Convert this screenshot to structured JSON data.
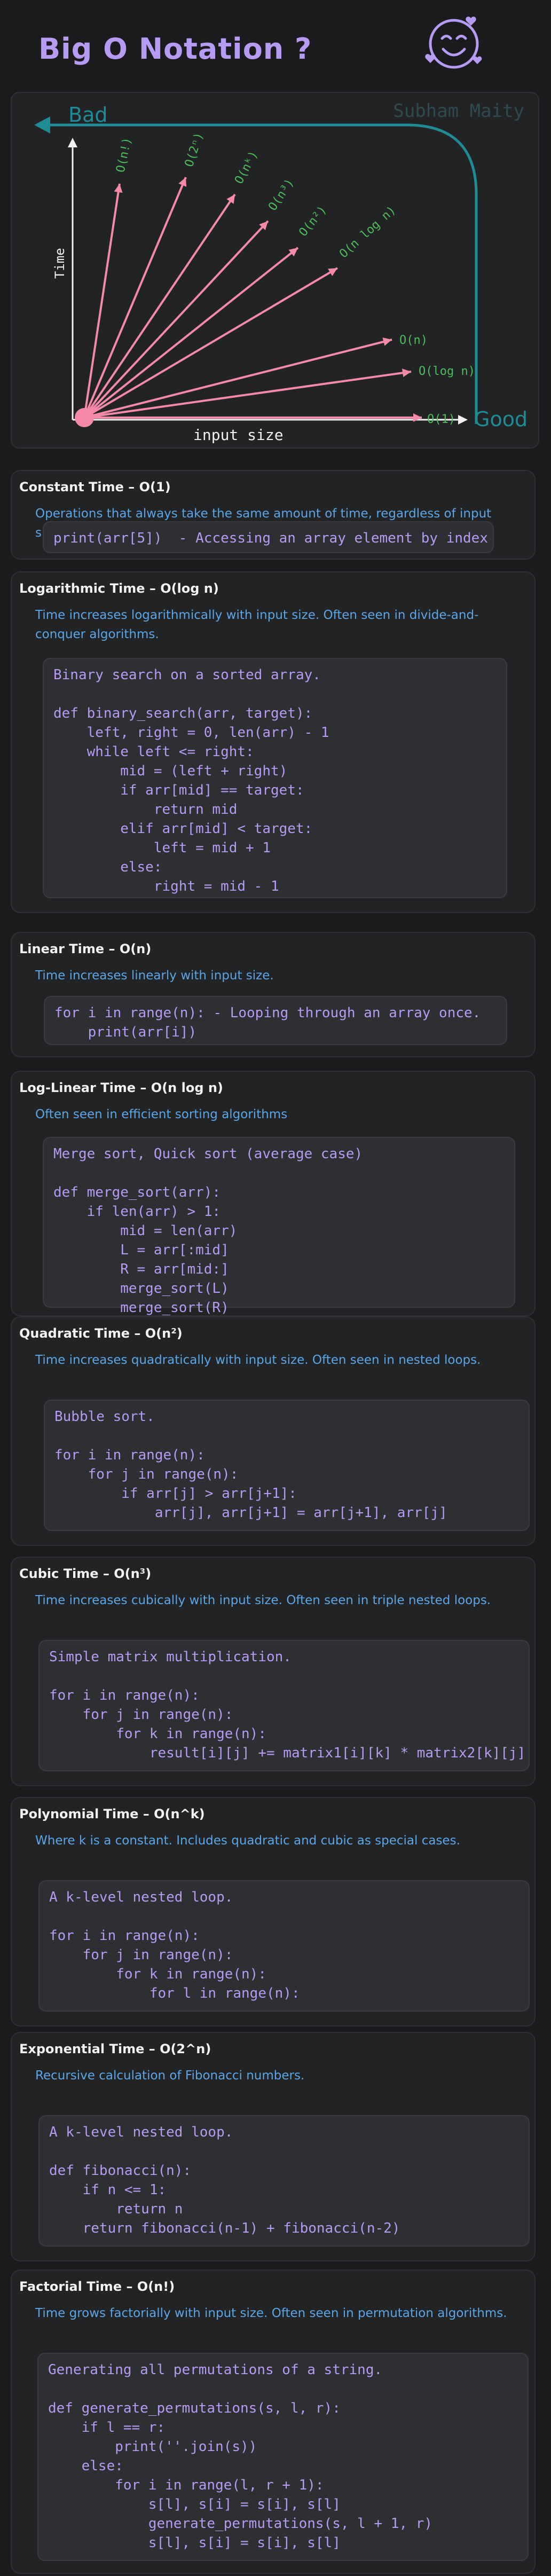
{
  "title": "Big O Notation ?",
  "logo_icon": "smiling-face-with-hearts",
  "graph": {
    "watermark": "Subham Maity",
    "bad_label": "Bad",
    "good_label": "Good",
    "ylabel": "Time",
    "xlabel": "input size",
    "curves": [
      "O(n!)",
      "O(2ⁿ)",
      "O(nᵏ)",
      "O(n³)",
      "O(n²)",
      "O(n log n)",
      "O(n)",
      "O(log n)",
      "O(1)"
    ]
  },
  "sections": [
    {
      "title": "Constant Time – O(1)",
      "desc": "Operations that always take the same amount of time, regardless of input size.",
      "code": "print(arr[5])  - Accessing an array element by index"
    },
    {
      "title": "Logarithmic Time – O(log n)",
      "desc": "Time increases logarithmically with input size. Often seen in divide-and-conquer algorithms.",
      "code": "Binary search on a sorted array.\n\ndef binary_search(arr, target):\n    left, right = 0, len(arr) - 1\n    while left <= right:\n        mid = (left + right)\n        if arr[mid] == target:\n            return mid\n        elif arr[mid] < target:\n            left = mid + 1\n        else:\n            right = mid - 1"
    },
    {
      "title": "Linear Time – O(n)",
      "desc": "Time increases linearly with input size.",
      "code": "for i in range(n): - Looping through an array once.\n    print(arr[i])"
    },
    {
      "title": "Log-Linear Time – O(n log n)",
      "desc": "Often seen in efficient sorting algorithms",
      "code": "Merge sort, Quick sort (average case)\n\ndef merge_sort(arr):\n    if len(arr) > 1:\n        mid = len(arr)\n        L = arr[:mid]\n        R = arr[mid:]\n        merge_sort(L)\n        merge_sort(R)"
    },
    {
      "title": "Quadratic Time – O(n²)",
      "desc": "Time increases quadratically with input size. Often seen in nested loops.",
      "code": "Bubble sort.\n\nfor i in range(n):\n    for j in range(n):\n        if arr[j] > arr[j+1]:\n            arr[j], arr[j+1] = arr[j+1], arr[j]"
    },
    {
      "title": "Cubic Time – O(n³)",
      "desc": "Time increases cubically with input size. Often seen in triple nested loops.",
      "code": "Simple matrix multiplication.\n\nfor i in range(n):\n    for j in range(n):\n        for k in range(n):\n            result[i][j] += matrix1[i][k] * matrix2[k][j]"
    },
    {
      "title": "Polynomial Time – O(n^k)",
      "desc": "Where k is a constant. Includes quadratic and cubic as special cases.",
      "code": "A k-level nested loop.\n\nfor i in range(n):\n    for j in range(n):\n        for k in range(n):\n            for l in range(n):"
    },
    {
      "title": "Exponential Time – O(2^n)",
      "desc": "Recursive calculation of Fibonacci numbers.",
      "code": "A k-level nested loop.\n\ndef fibonacci(n):\n    if n <= 1:\n        return n\n    return fibonacci(n-1) + fibonacci(n-2)"
    },
    {
      "title": "Factorial Time – O(n!)",
      "desc": "Time grows factorially with input size. Often seen in permutation algorithms.",
      "code": "Generating all permutations of a string.\n\ndef generate_permutations(s, l, r):\n    if l == r:\n        print(''.join(s))\n    else:\n        for i in range(l, r + 1):\n            s[l], s[i] = s[i], s[l]\n            generate_permutations(s, l + 1, r)\n            s[l], s[i] = s[i], s[l]"
    }
  ]
}
